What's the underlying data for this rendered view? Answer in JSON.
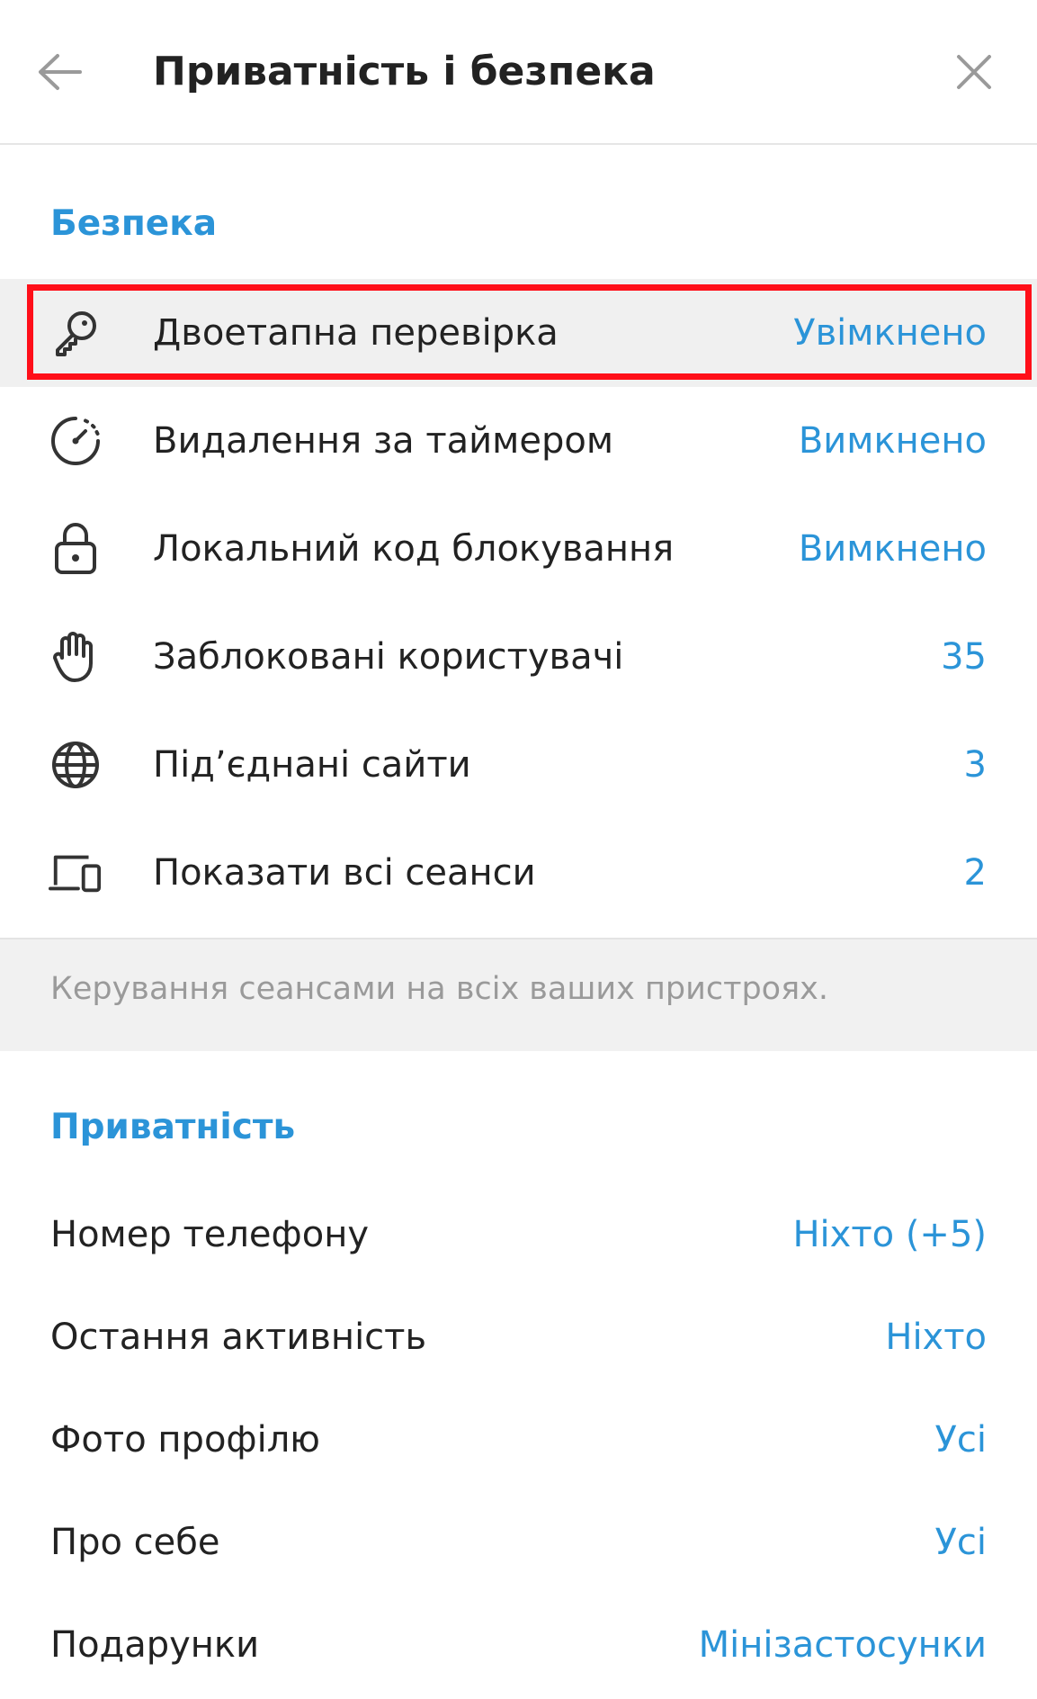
{
  "header": {
    "title": "Приватність і безпека",
    "back_icon": "arrow-left-icon",
    "close_icon": "close-icon"
  },
  "security": {
    "section_title": "Безпека",
    "items": [
      {
        "label": "Двоетапна перевірка",
        "value": "Увімкнено",
        "icon": "key-icon",
        "highlighted": true
      },
      {
        "label": "Видалення за таймером",
        "value": "Вимкнено",
        "icon": "timer-icon"
      },
      {
        "label": "Локальний код блокування",
        "value": "Вимкнено",
        "icon": "lock-icon"
      },
      {
        "label": "Заблоковані користувачі",
        "value": "35",
        "icon": "hand-icon"
      },
      {
        "label": "Під’єднані сайти",
        "value": "3",
        "icon": "globe-icon"
      },
      {
        "label": "Показати всі сеанси",
        "value": "2",
        "icon": "devices-icon"
      }
    ],
    "footer_note": "Керування сеансами на всіх ваших пристроях."
  },
  "privacy": {
    "section_title": "Приватність",
    "items": [
      {
        "label": "Номер телефону",
        "value": "Ніхто (+5)"
      },
      {
        "label": "Остання активність",
        "value": "Ніхто"
      },
      {
        "label": "Фото профілю",
        "value": "Усі"
      },
      {
        "label": "Про себе",
        "value": "Усі"
      },
      {
        "label": "Подарунки",
        "value": "Мінізастосунки"
      }
    ]
  },
  "colors": {
    "accent": "#2b94d8",
    "highlight_border": "#ff0f19",
    "active_row_bg": "#f0f0f0",
    "info_band_bg": "#f1f1f1",
    "muted_text": "#9a9a9a"
  }
}
